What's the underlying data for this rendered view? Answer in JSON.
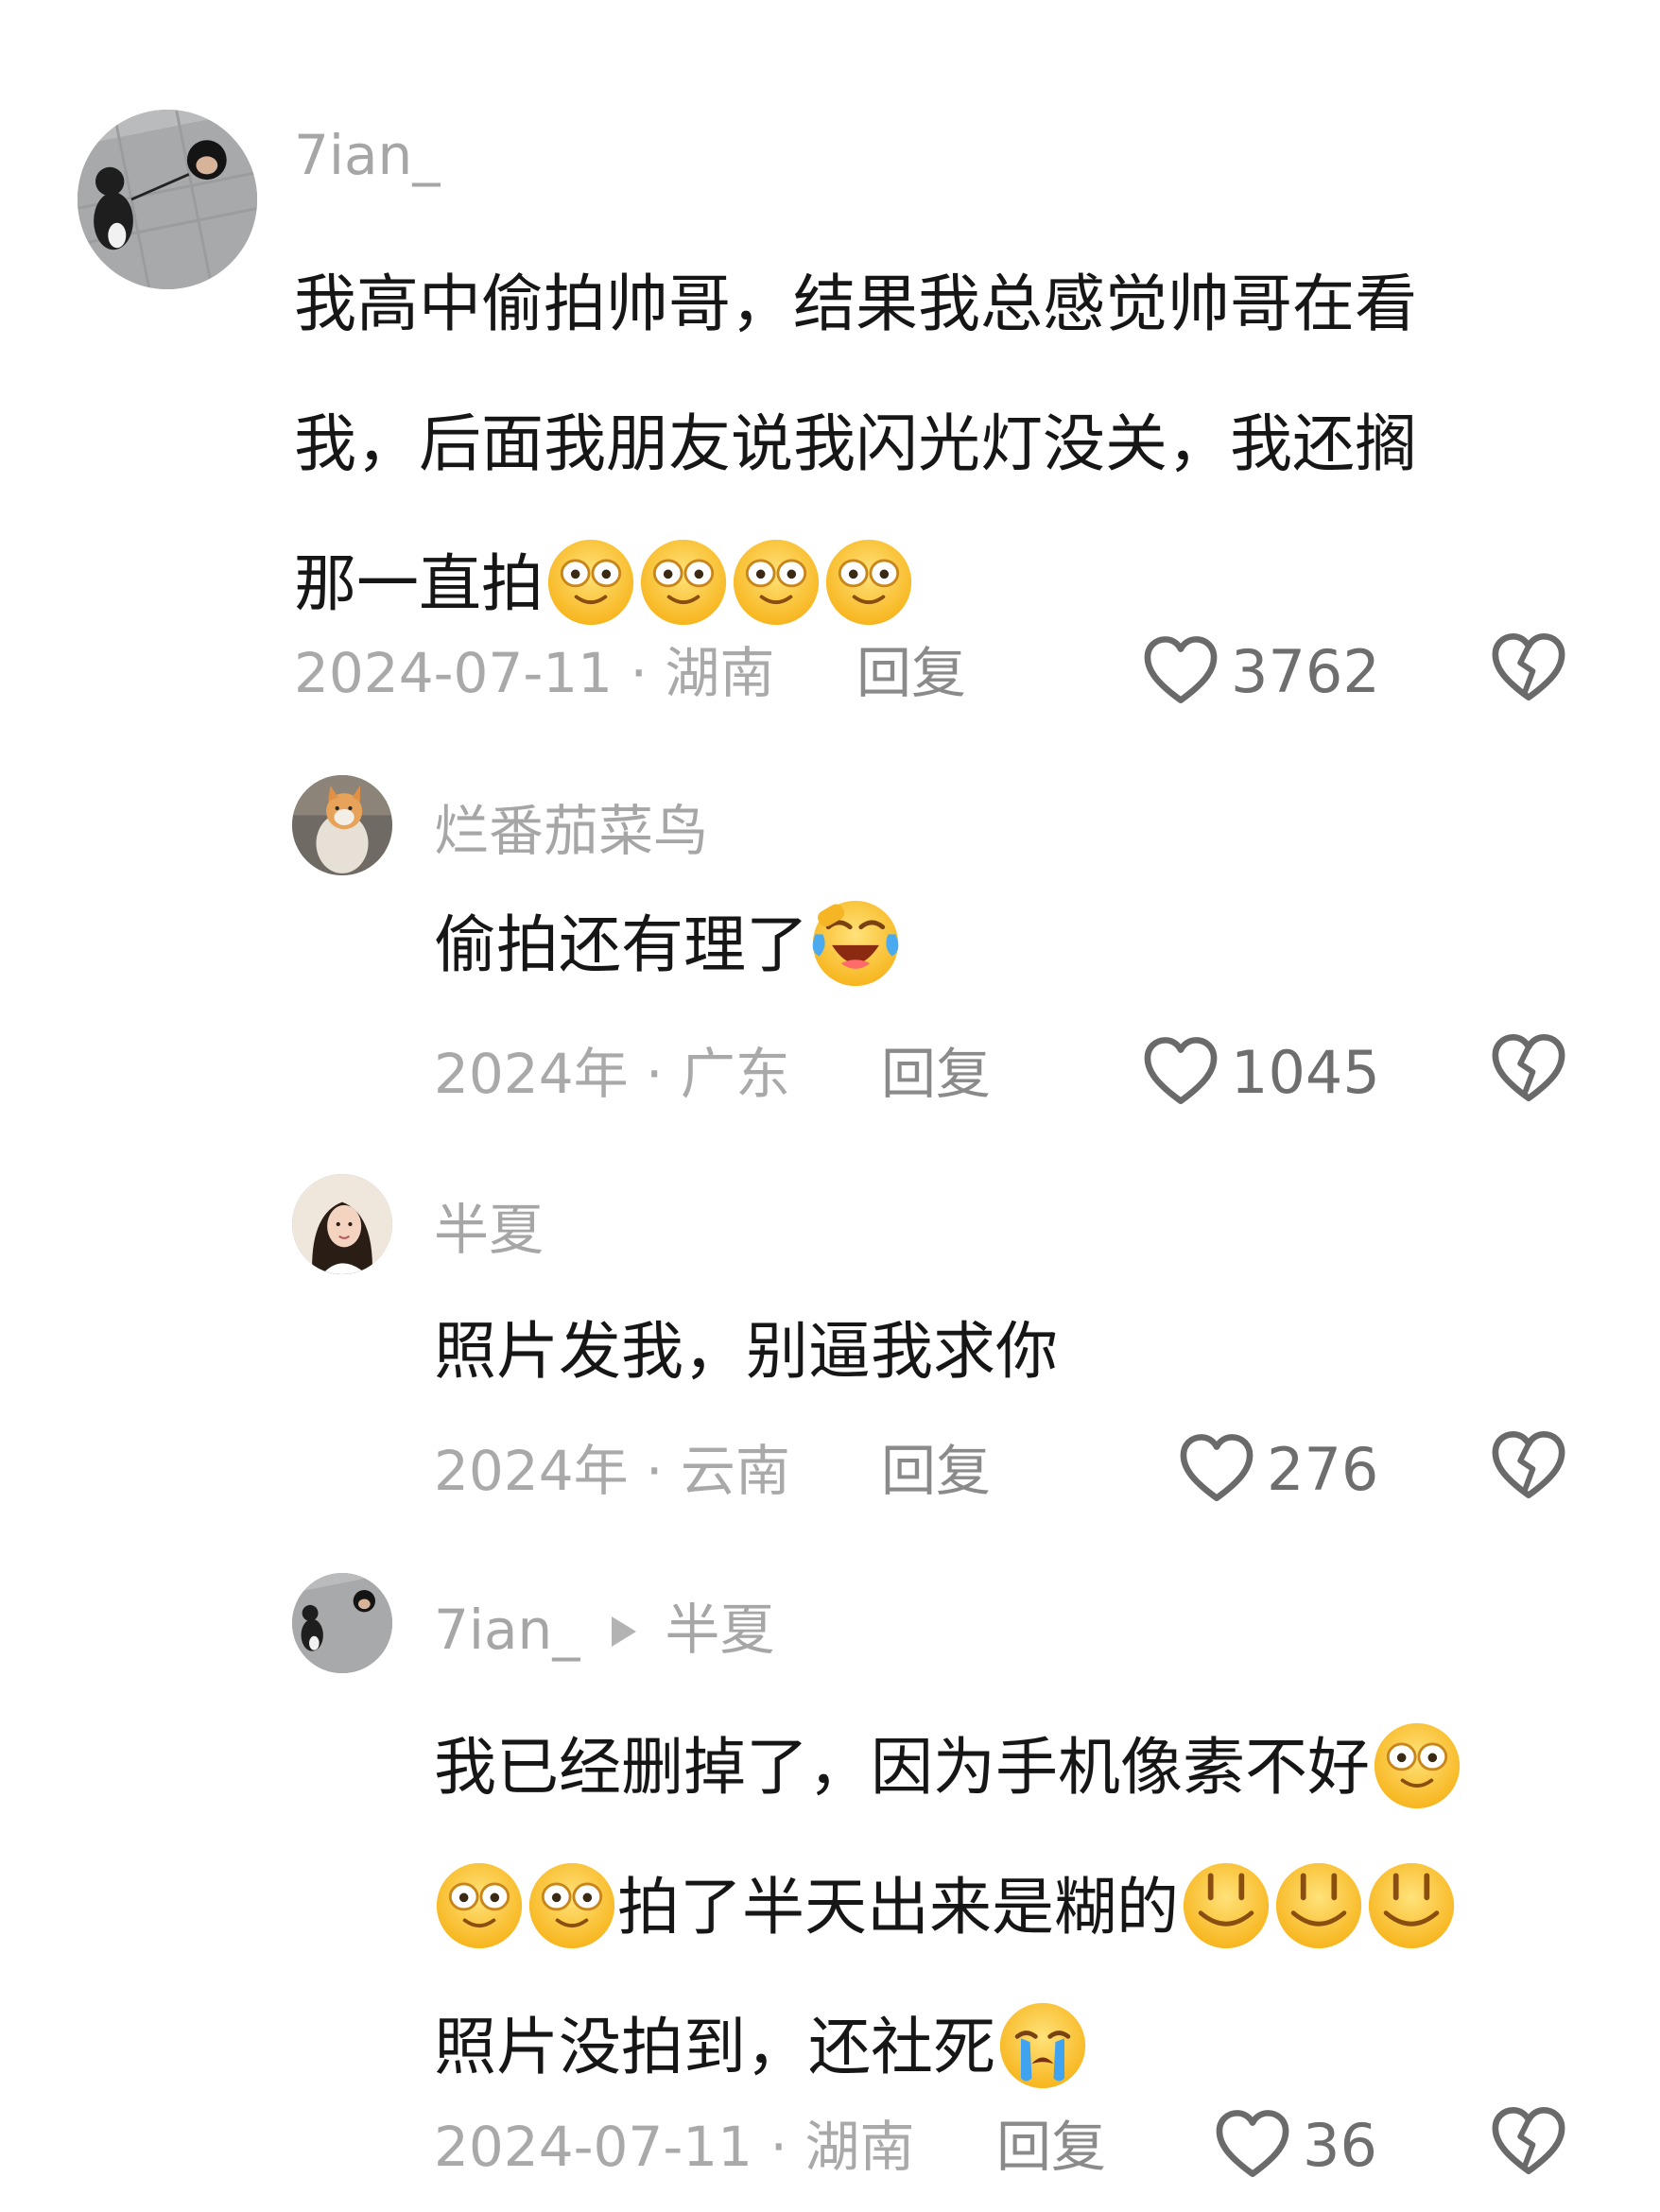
{
  "comments": [
    {
      "username": "7ian_",
      "lines": [
        "我高中偷拍帅哥，结果我总感觉帅哥在看",
        "我，后面我朋友说我闪光灯没关，我还搁",
        "那一直拍"
      ],
      "emoji_icons": [
        "wide-eyed-smile-emoji",
        "wide-eyed-smile-emoji",
        "wide-eyed-smile-emoji",
        "wide-eyed-smile-emoji"
      ],
      "meta": "2024-07-11 · 湖南",
      "reply": "回复",
      "likes": "3762"
    },
    {
      "username": "烂番茄菜鸟",
      "lines": [
        "偷拍还有理了"
      ],
      "emoji_icons": [
        "laughing-tears-emoji"
      ],
      "meta": "2024年 · 广东",
      "reply": "回复",
      "likes": "1045"
    },
    {
      "username": "半夏",
      "lines": [
        "照片发我，别逼我求你"
      ],
      "meta": "2024年 · 云南",
      "reply": "回复",
      "likes": "276"
    },
    {
      "username": "7ian_",
      "reply_to": "半夏",
      "lines": [
        "我已经删掉了，因为手机像素不好",
        "拍了半天出来是糊的",
        "照片没拍到，还社死"
      ],
      "emoji_icons": [
        "wide-eyed-smile-emoji",
        "wide-eyed-smile-emoji",
        "wide-eyed-smile-emoji",
        "awkward-smile-emoji",
        "awkward-smile-emoji",
        "awkward-smile-emoji",
        "crying-emoji"
      ],
      "meta": "2024-07-11 · 湖南",
      "reply": "回复",
      "likes": "36"
    }
  ],
  "icons": {
    "like": "heart-outline-icon",
    "dislike": "broken-heart-icon",
    "reply_arrow": "triangle-right-icon"
  },
  "colors": {
    "username": "#a6a6a6",
    "meta": "#a9a9a9",
    "text": "#161616",
    "emoji": "#ffc629"
  }
}
